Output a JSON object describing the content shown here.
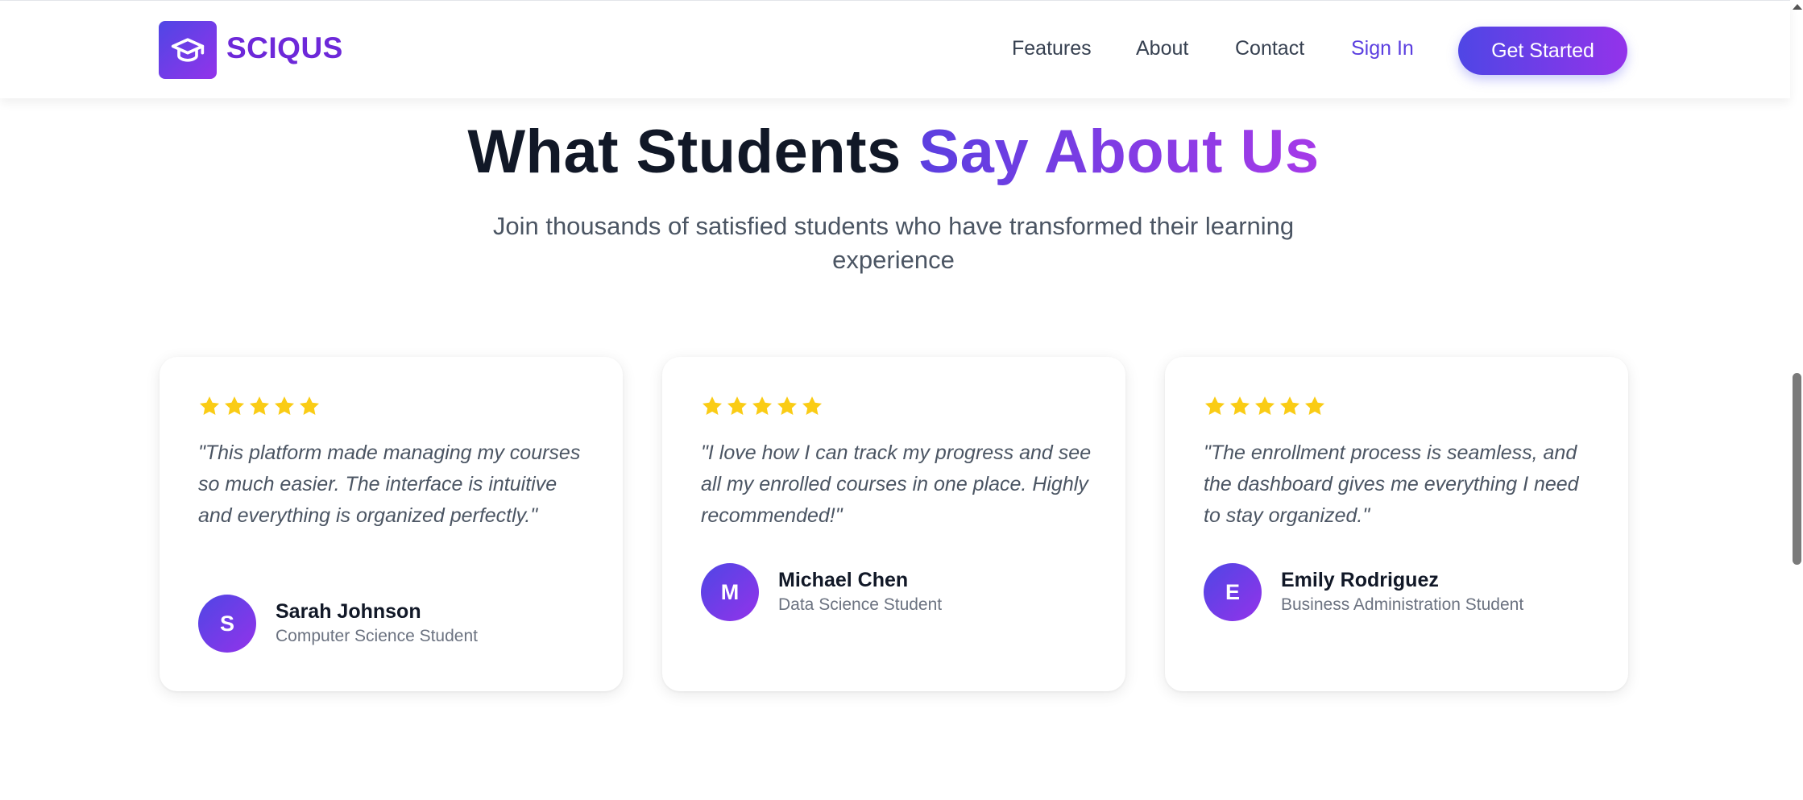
{
  "header": {
    "logo_text": "SCIQUS",
    "logo_icon": "graduation-cap-icon",
    "nav": {
      "features": "Features",
      "about": "About",
      "contact": "Contact",
      "sign_in": "Sign In"
    },
    "cta_label": "Get Started"
  },
  "section": {
    "title_main": "What Students ",
    "title_accent": "Say About Us",
    "subtitle": "Join thousands of satisfied students who have transformed their learning experience"
  },
  "testimonials": [
    {
      "rating": 5,
      "quote": "\"This platform made managing my courses so much easier. The interface is intuitive and everything is organized perfectly.\"",
      "initial": "S",
      "name": "Sarah Johnson",
      "role": "Computer Science Student"
    },
    {
      "rating": 5,
      "quote": "\"I love how I can track my progress and see all my enrolled courses in one place. Highly recommended!\"",
      "initial": "M",
      "name": "Michael Chen",
      "role": "Data Science Student"
    },
    {
      "rating": 5,
      "quote": "\"The enrollment process is seamless, and the dashboard gives me everything I need to stay organized.\"",
      "initial": "E",
      "name": "Emily Rodriguez",
      "role": "Business Administration Student"
    }
  ],
  "colors": {
    "brand_start": "#4f46e5",
    "brand_end": "#9333ea",
    "star": "#facc15",
    "heading": "#111827"
  }
}
